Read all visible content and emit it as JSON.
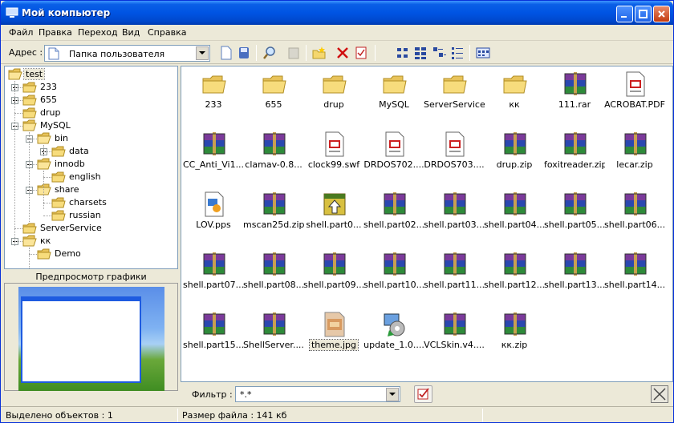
{
  "window": {
    "title": "Мой компьютер"
  },
  "menu": [
    "Файл",
    "Правка",
    "Переход",
    "Вид",
    "Справка"
  ],
  "address": {
    "label": "Адрес :",
    "value": "Папка пользователя"
  },
  "tree": [
    {
      "label": "test",
      "depth": 0,
      "expanded": true,
      "toggle": "none",
      "selected": true
    },
    {
      "label": "233",
      "depth": 1,
      "toggle": "plus"
    },
    {
      "label": "655",
      "depth": 1,
      "toggle": "plus"
    },
    {
      "label": "drup",
      "depth": 1,
      "toggle": "none"
    },
    {
      "label": "MySQL",
      "depth": 1,
      "toggle": "minus"
    },
    {
      "label": "bin",
      "depth": 2,
      "toggle": "minus"
    },
    {
      "label": "data",
      "depth": 3,
      "toggle": "plus"
    },
    {
      "label": "innodb",
      "depth": 2,
      "toggle": "minus"
    },
    {
      "label": "english",
      "depth": 3,
      "toggle": "none"
    },
    {
      "label": "share",
      "depth": 2,
      "toggle": "minus"
    },
    {
      "label": "charsets",
      "depth": 3,
      "toggle": "none"
    },
    {
      "label": "russian",
      "depth": 3,
      "toggle": "none"
    },
    {
      "label": "ServerService",
      "depth": 1,
      "toggle": "none"
    },
    {
      "label": "кк",
      "depth": 1,
      "toggle": "minus"
    },
    {
      "label": "Demo",
      "depth": 2,
      "toggle": "none"
    }
  ],
  "preview": {
    "title": "Предпросмотр графики"
  },
  "files": [
    {
      "name": "233",
      "icon": "folder-icon"
    },
    {
      "name": "655",
      "icon": "folder-icon"
    },
    {
      "name": "drup",
      "icon": "folder-icon"
    },
    {
      "name": "MySQL",
      "icon": "folder-icon"
    },
    {
      "name": "ServerService",
      "icon": "folder-icon"
    },
    {
      "name": "кк",
      "icon": "folder-icon"
    },
    {
      "name": "111.rar",
      "icon": "archive-icon"
    },
    {
      "name": "ACROBAT.PDF",
      "icon": "document-icon"
    },
    {
      "name": "CC_Anti_Vi1...",
      "icon": "archive-icon"
    },
    {
      "name": "clamav-0.8...",
      "icon": "archive-icon"
    },
    {
      "name": "clock99.swf",
      "icon": "document-icon"
    },
    {
      "name": "DRDOS702....",
      "icon": "document-icon"
    },
    {
      "name": "DRDOS703....",
      "icon": "document-icon"
    },
    {
      "name": "drup.zip",
      "icon": "archive-icon"
    },
    {
      "name": "foxitreader.zip",
      "icon": "archive-icon"
    },
    {
      "name": "lecar.zip",
      "icon": "archive-icon"
    },
    {
      "name": "LOV.pps",
      "icon": "presentation-icon"
    },
    {
      "name": "mscan25d.zip",
      "icon": "archive-icon"
    },
    {
      "name": "shell.part0...",
      "icon": "installer-archive-icon"
    },
    {
      "name": "shell.part02...",
      "icon": "archive-icon"
    },
    {
      "name": "shell.part03....",
      "icon": "archive-icon"
    },
    {
      "name": "shell.part04....",
      "icon": "archive-icon"
    },
    {
      "name": "shell.part05....",
      "icon": "archive-icon"
    },
    {
      "name": "shell.part06....",
      "icon": "archive-icon"
    },
    {
      "name": "shell.part07....",
      "icon": "archive-icon"
    },
    {
      "name": "shell.part08....",
      "icon": "archive-icon"
    },
    {
      "name": "shell.part09....",
      "icon": "archive-icon"
    },
    {
      "name": "shell.part10....",
      "icon": "archive-icon"
    },
    {
      "name": "shell.part11....",
      "icon": "archive-icon"
    },
    {
      "name": "shell.part12....",
      "icon": "archive-icon"
    },
    {
      "name": "shell.part13....",
      "icon": "archive-icon"
    },
    {
      "name": "shell.part14....",
      "icon": "archive-icon"
    },
    {
      "name": "shell.part15....",
      "icon": "archive-icon"
    },
    {
      "name": "ShellServer....",
      "icon": "archive-icon"
    },
    {
      "name": "theme.jpg",
      "icon": "image-icon",
      "selected": true
    },
    {
      "name": "update_1.0....",
      "icon": "setup-icon"
    },
    {
      "name": "VCLSkin.v4....",
      "icon": "archive-icon"
    },
    {
      "name": "кк.zip",
      "icon": "archive-icon"
    }
  ],
  "filter": {
    "label": "Фильтр :",
    "value": "*.*"
  },
  "status": {
    "selected": "Выделено объектов : 1",
    "size": "Размер файла : 141 кб"
  },
  "colors": {
    "titlebar": "#0054e3",
    "selection": "#ece9d8",
    "face": "#ece9d8"
  }
}
